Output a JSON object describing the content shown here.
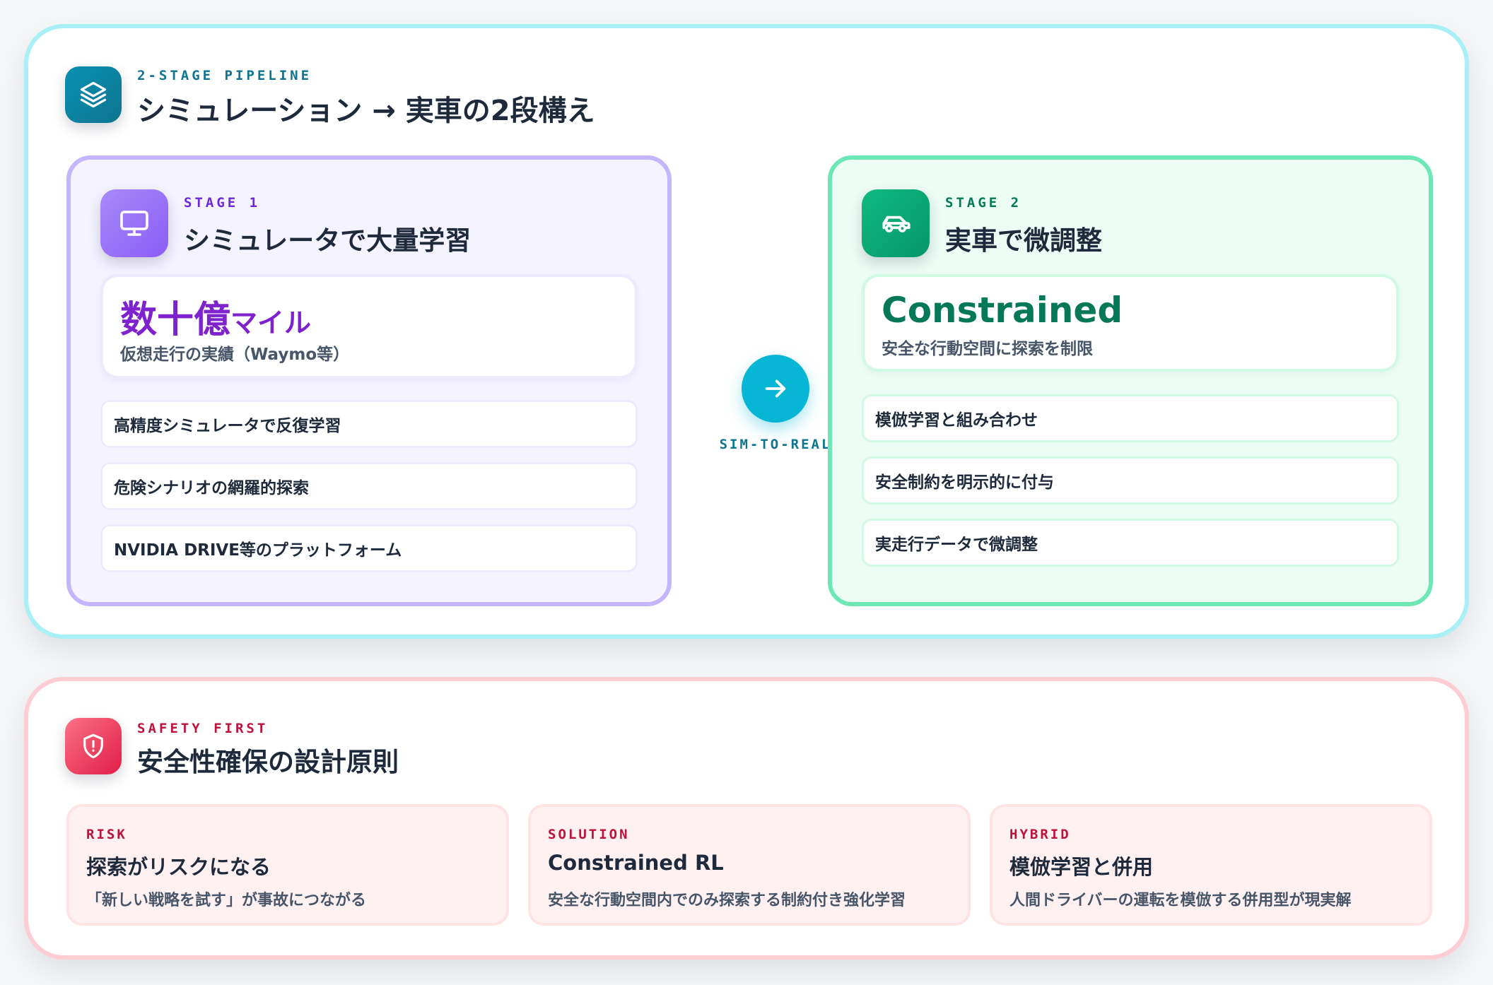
{
  "pipeline": {
    "eyebrow": "2-STAGE PIPELINE",
    "title": "シミュレーション → 実車の2段構え",
    "icon": "layers-icon",
    "stage1": {
      "eyebrow": "STAGE 1",
      "title": "シミュレータで大量学習",
      "icon": "monitor-icon",
      "hero_big": "数十億",
      "hero_big_suffix": "マイル",
      "hero_sub": "仮想走行の実績（Waymo等）",
      "items": [
        "高精度シミュレータで反復学習",
        "危険シナリオの網羅的探索",
        "NVIDIA DRIVE等のプラットフォーム"
      ]
    },
    "connector": {
      "label": "SIM-TO-REAL",
      "icon": "arrow-right-icon"
    },
    "stage2": {
      "eyebrow": "STAGE 2",
      "title": "実車で微調整",
      "icon": "car-icon",
      "hero_big": "Constrained",
      "hero_sub": "安全な行動空間に探索を制限",
      "items": [
        "模倣学習と組み合わせ",
        "安全制約を明示的に付与",
        "実走行データで微調整"
      ]
    }
  },
  "safety": {
    "eyebrow": "SAFETY FIRST",
    "title": "安全性確保の設計原則",
    "icon": "shield-alert-icon",
    "cards": [
      {
        "label": "RISK",
        "title": "探索がリスクになる",
        "desc": "「新しい戦略を試す」が事故につながる"
      },
      {
        "label": "SOLUTION",
        "title": "Constrained RL",
        "desc": "安全な行動空間内でのみ探索する制約付き強化学習"
      },
      {
        "label": "HYBRID",
        "title": "模倣学習と併用",
        "desc": "人間ドライバーの運転を模倣する併用型が現実解"
      }
    ]
  },
  "colors": {
    "cyan": "#06b6d4",
    "purple": "#8b5cf6",
    "green": "#10b981",
    "rose": "#f43f5e",
    "stage1_accent": "#6d28d9",
    "stage2_accent": "#047857"
  }
}
